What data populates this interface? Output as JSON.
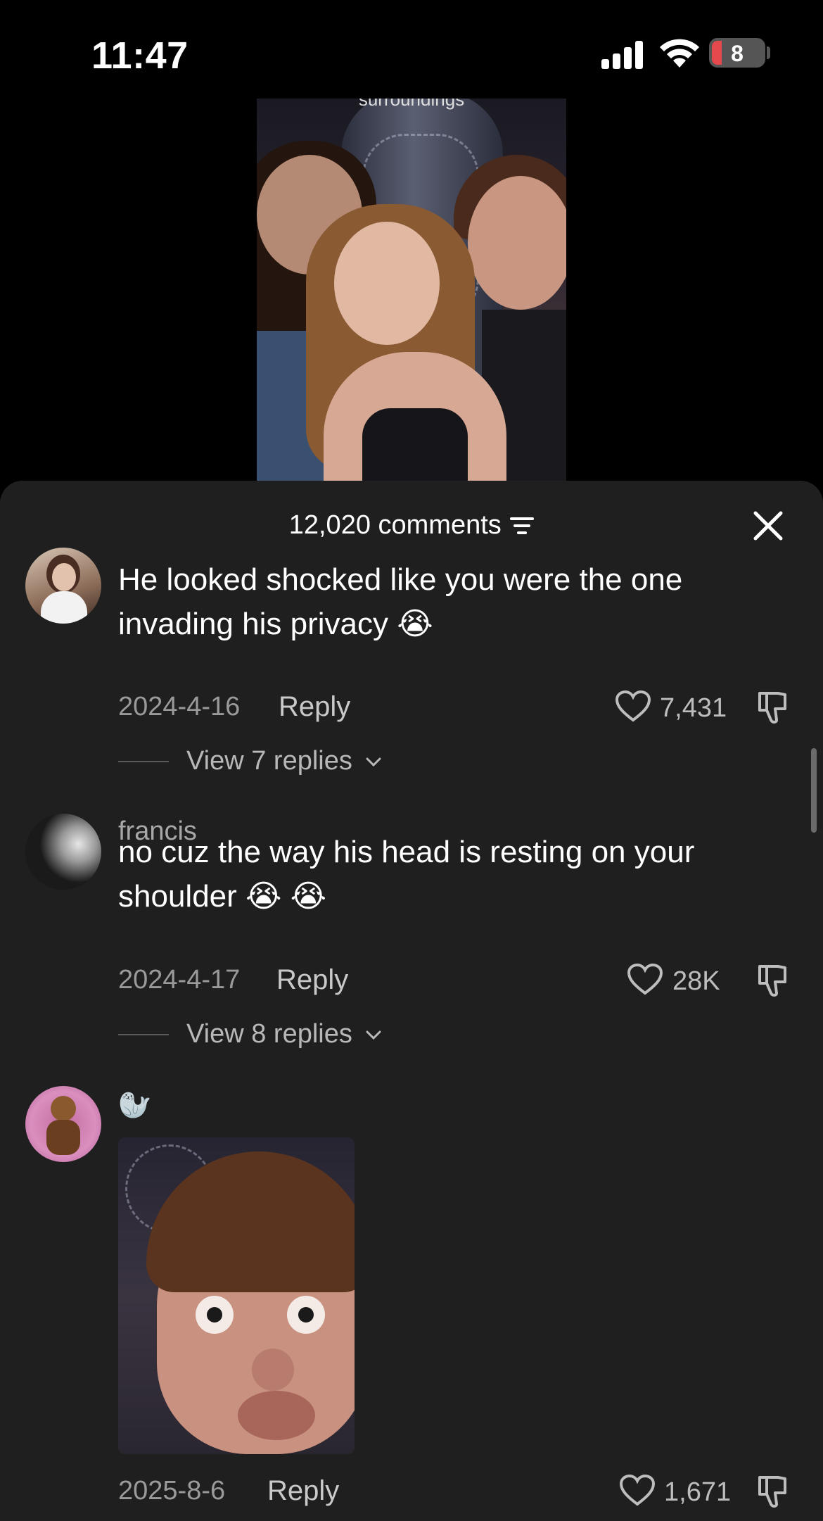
{
  "status_bar": {
    "time": "11:47",
    "battery": "8"
  },
  "video": {
    "caption_fragment": "surroundings"
  },
  "sheet": {
    "comment_count": "12,020 comments"
  },
  "comments": [
    {
      "username": "",
      "text": "He looked shocked like you were the one invading his privacy 😭",
      "date": "2024-4-16",
      "reply_label": "Reply",
      "likes": "7,431",
      "view_replies": "View 7 replies"
    },
    {
      "username": "francis",
      "text": "no cuz the way his head is resting on your shoulder 😭 😭",
      "date": "2024-4-17",
      "reply_label": "Reply",
      "likes": "28K",
      "view_replies": "View 8 replies"
    },
    {
      "username": "🦭",
      "text": "",
      "date": "2025-8-6",
      "reply_label": "Reply",
      "likes": "1,671",
      "view_replies": ""
    }
  ],
  "colors": {
    "sheet_bg": "#1f1f1f",
    "text_primary": "#ffffff",
    "text_secondary": "#9a9a9a",
    "battery_low": "#e5484d"
  },
  "icons": [
    "signal-icon",
    "wifi-icon",
    "battery-icon",
    "filter-icon",
    "close-icon",
    "heart-icon",
    "dislike-icon",
    "chevron-down-icon"
  ]
}
